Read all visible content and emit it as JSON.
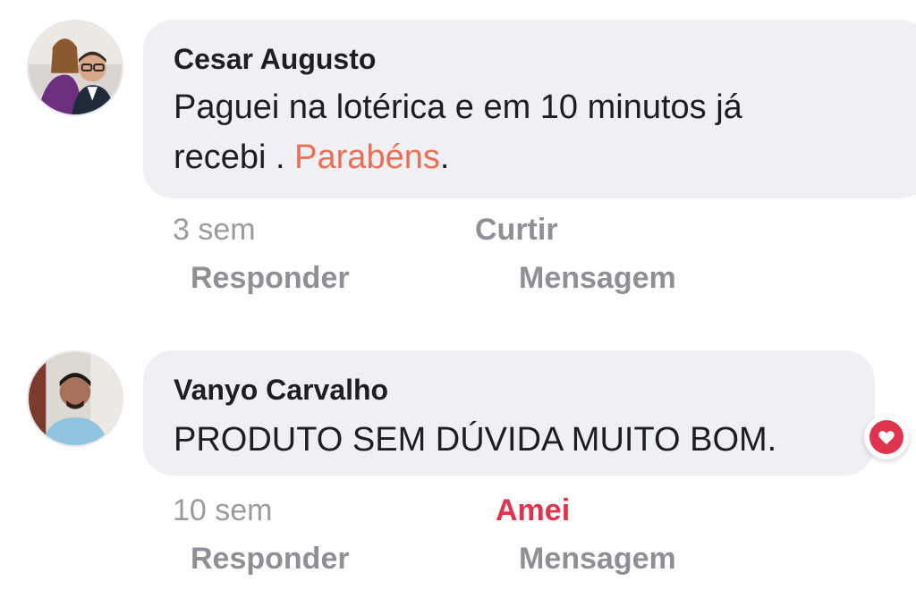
{
  "comments": [
    {
      "author": "Cesar Augusto",
      "text_before": "Paguei na lotérica e em 10 minutos já",
      "text_line2_before": "recebi . ",
      "text_highlight": "Parabéns",
      "text_after": ".",
      "time": "3 sem",
      "like_label": "Curtir",
      "reply_label": "Responder",
      "message_label": "Mensagem"
    },
    {
      "author": "Vanyo Carvalho",
      "text": "PRODUTO SEM DÚVIDA MUITO BOM.",
      "time": "10 sem",
      "like_label": "Amei",
      "reply_label": "Responder",
      "message_label": "Mensagem",
      "reaction_icon": "heart-icon"
    }
  ],
  "colors": {
    "bubble": "#eff0f3",
    "highlight": "#ea6f56",
    "love": "#e0344e",
    "meta": "#9a9ba0"
  }
}
